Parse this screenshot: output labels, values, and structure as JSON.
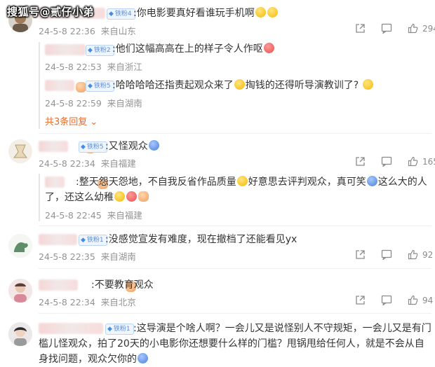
{
  "watermark": "搜狐号@贰仔小弟",
  "comments": [
    {
      "badge": "铁粉4",
      "text": ":你电影要真好看谁玩手机啊",
      "date": "24-5-8 22:36",
      "location": "来自山东",
      "likes": "294",
      "replies": [
        {
          "badge": "铁粉2",
          "text": ":他们这幅高高在上的样子令人作呕",
          "date": "24-5-8 22:53",
          "location": "来自浙江"
        },
        {
          "badge": "铁粉5",
          "text": ":哈哈哈哈还指责起观众来了",
          "text2": "掏钱的还得听导演教训了?",
          "date": "24-5-8 22:59",
          "location": "来自湖南"
        }
      ],
      "more": "共3条回复"
    },
    {
      "badge": "铁粉5",
      "text": ":又怪观众",
      "date": "24-5-8 22:34",
      "location": "来自福建",
      "likes": "165",
      "replies": [
        {
          "text": ":整天怨天怨地，不自我反省作品质量",
          "text2": "好意思去评判观众，真可笑",
          "text3": "这么大的人了，还这么幼稚",
          "date": "24-5-8 22:45",
          "location": "来自福建"
        }
      ]
    },
    {
      "badge": "铁粉1",
      "text": ":没感觉宣发有难度，现在撤档了还能看见yx",
      "date": "24-5-8 22:35",
      "location": "来自湖南",
      "likes": "92"
    },
    {
      "text": ":不要教育观众",
      "date": "24-5-8 22:34",
      "location": "来自北京",
      "likes": "94"
    },
    {
      "badge": "铁粉1",
      "text": ":这导演是个啥人啊？一会儿又是说怪别人不守规矩，一会儿又是有门槛儿怪观众，拍了20天的小电影你还想要什么样的门槛？甩锅甩给任何人，就是不会从自身找问题，观众欠你的"
    }
  ],
  "icons": {
    "share": "share-icon",
    "comment": "comment-icon",
    "like": "like-icon"
  }
}
